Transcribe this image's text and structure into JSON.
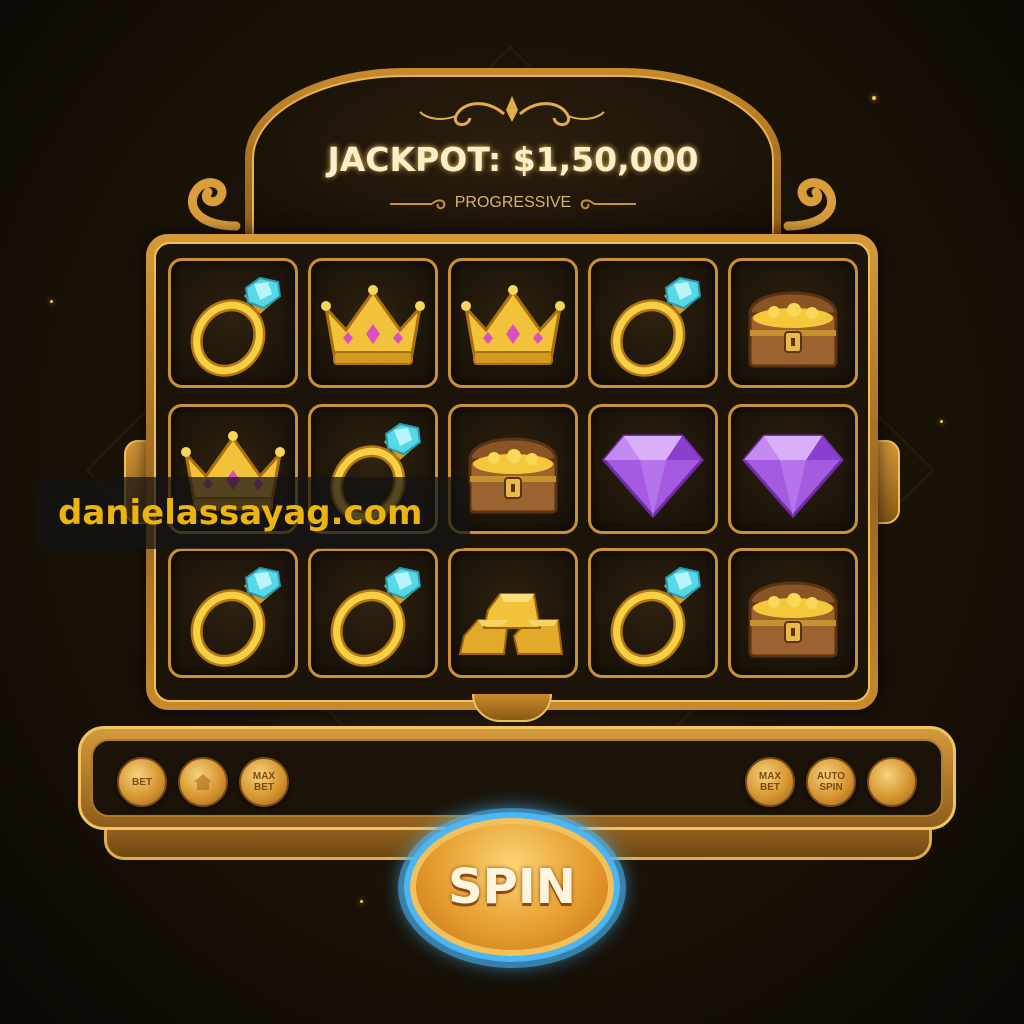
{
  "header": {
    "jackpot_text": "JACKPOT: $1,50,000",
    "subtitle": "PROGRESSIVE"
  },
  "reels": {
    "rows": [
      [
        "ring",
        "crown",
        "crown",
        "ring",
        "treasure-chest"
      ],
      [
        "crown",
        "ring",
        "treasure-chest",
        "purple-diamond",
        "purple-diamond"
      ],
      [
        "ring",
        "ring",
        "gold-bars",
        "ring",
        "treasure-chest"
      ]
    ]
  },
  "controls": {
    "left": [
      {
        "label": "BET",
        "icon": "bet-icon"
      },
      {
        "label": "",
        "icon": "home-icon"
      },
      {
        "label": "MAX\nBET",
        "icon": "max-bet-icon"
      }
    ],
    "right": [
      {
        "label": "MAX\nBET",
        "icon": "max-bet-icon"
      },
      {
        "label": "AUTO\nSPIN",
        "icon": "auto-spin-icon"
      },
      {
        "label": "",
        "icon": "blank-button"
      }
    ]
  },
  "spin_label": "SPIN",
  "watermark": "danielassayag.com",
  "colors": {
    "gold": "#d69a38",
    "gold_light": "#f1c45e",
    "spin_ring": "#4bb6f3",
    "watermark_text": "#ecb40e",
    "amethyst": "#a55be0"
  }
}
